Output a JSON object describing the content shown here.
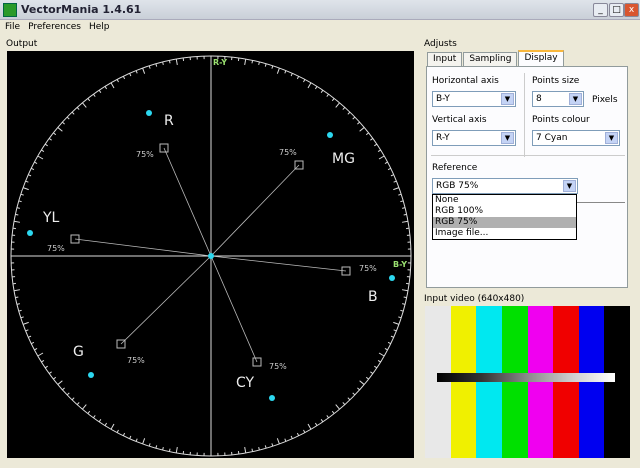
{
  "window": {
    "title": "VectorMania 1.4.61",
    "min": "_",
    "max": "□",
    "close": "x"
  },
  "menu": [
    "File",
    "Preferences",
    "Help"
  ],
  "output_label": "Output",
  "adjusts_label": "Adjusts",
  "tabs": [
    "Input",
    "Sampling",
    "Display"
  ],
  "display": {
    "horizontal_axis_label": "Horizontal axis",
    "horizontal_axis_value": "B-Y",
    "vertical_axis_label": "Vertical axis",
    "vertical_axis_value": "R-Y",
    "points_size_label": "Points size",
    "points_size_value": "8",
    "points_size_unit": "Pixels",
    "points_colour_label": "Points colour",
    "points_colour_value": "7 Cyan",
    "reference_label": "Reference",
    "reference_value": "RGB 75%",
    "reference_options": [
      "None",
      "RGB 100%",
      "RGB 75%",
      "Image file..."
    ],
    "reference_selected": "RGB 75%"
  },
  "scope": {
    "axis_v": "R-Y",
    "axis_h": "B-Y",
    "target_label": "75%",
    "labels": [
      "R",
      "MG",
      "YL",
      "B",
      "G",
      "CY"
    ]
  },
  "input_video_label": "Input video (640x480)",
  "colors": {
    "bars": [
      "#e8e8e8",
      "#f0f000",
      "#00e8f0",
      "#00e000",
      "#f000f0",
      "#f00000",
      "#0000f0",
      "#000000"
    ],
    "accent": "#9ae070"
  }
}
